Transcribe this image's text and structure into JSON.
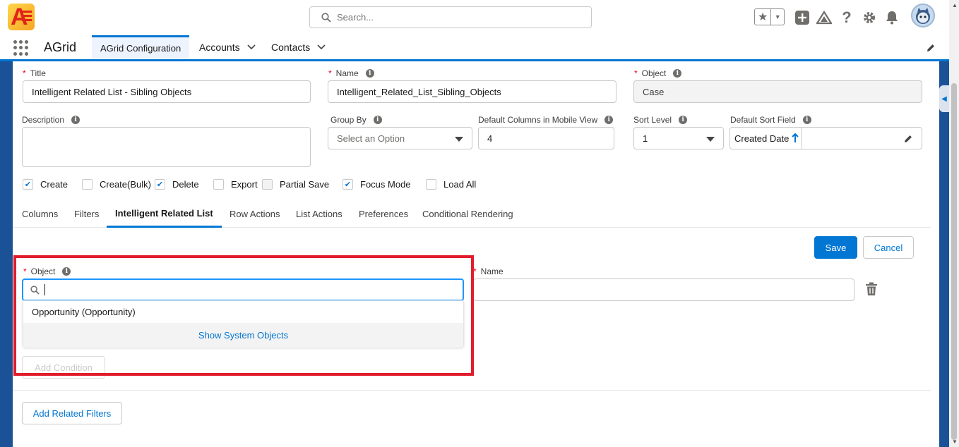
{
  "header": {
    "search_placeholder": "Search...",
    "icons": [
      "favorites-star-icon",
      "add-icon",
      "trailhead-icon",
      "help-icon",
      "settings-icon",
      "notifications-icon",
      "avatar"
    ]
  },
  "nav": {
    "app_name": "AGrid",
    "tabs": [
      {
        "label": "AGrid Configuration",
        "active": true
      },
      {
        "label": "Accounts",
        "has_menu": true
      },
      {
        "label": "Contacts",
        "has_menu": true
      }
    ]
  },
  "form": {
    "title": {
      "label": "Title",
      "required": true,
      "value": "Intelligent Related List - Sibling Objects"
    },
    "name": {
      "label": "Name",
      "required": true,
      "value": "Intelligent_Related_List_Sibling_Objects"
    },
    "object": {
      "label": "Object",
      "required": true,
      "value": "Case"
    },
    "description": {
      "label": "Description",
      "value": ""
    },
    "group_by": {
      "label": "Group By",
      "placeholder": "Select an Option"
    },
    "default_columns_mobile": {
      "label": "Default Columns in Mobile View",
      "value": "4"
    },
    "sort_level": {
      "label": "Sort Level",
      "value": "1"
    },
    "default_sort_field": {
      "label": "Default Sort Field",
      "value": "Created Date"
    }
  },
  "checkboxes": [
    {
      "label": "Create",
      "checked": true
    },
    {
      "label": "Create(Bulk)",
      "checked": false
    },
    {
      "label": "Delete",
      "checked": true
    },
    {
      "label": "Export",
      "checked": false
    },
    {
      "label": "Partial Save",
      "checked": false,
      "disabled": true
    },
    {
      "label": "Focus Mode",
      "checked": true
    },
    {
      "label": "Load All",
      "checked": false
    }
  ],
  "tabs": [
    {
      "label": "Columns"
    },
    {
      "label": "Filters"
    },
    {
      "label": "Intelligent Related List",
      "active": true
    },
    {
      "label": "Row Actions"
    },
    {
      "label": "List Actions"
    },
    {
      "label": "Preferences"
    },
    {
      "label": "Conditional Rendering"
    }
  ],
  "related": {
    "save_label": "Save",
    "cancel_label": "Cancel",
    "object_label": "Object",
    "name_label": "Name",
    "search_value": "",
    "dropdown_option": "Opportunity (Opportunity)",
    "show_system_objects": "Show System Objects",
    "add_condition": "Add Condition",
    "add_related_filters": "Add Related Filters"
  },
  "colors": {
    "brand": "#0176d3",
    "highlight": "#e11d2b",
    "required": "#ea001e"
  }
}
